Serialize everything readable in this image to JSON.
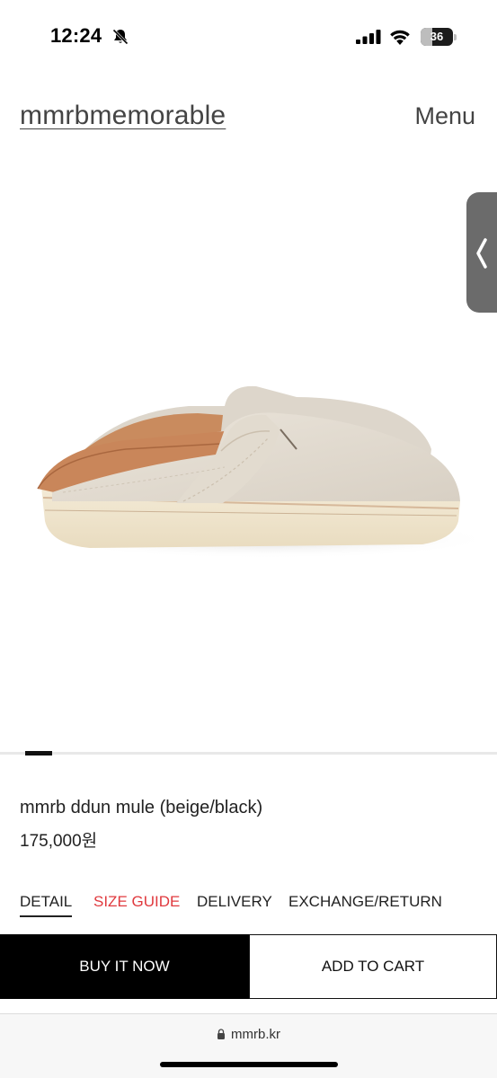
{
  "status_bar": {
    "time": "12:24",
    "battery": "36",
    "battery_level": 0.36,
    "icons": [
      "bell-slash-icon",
      "cellular-signal-icon",
      "wifi-icon",
      "battery-icon"
    ]
  },
  "header": {
    "brand": "mmrbmemorable",
    "menu_label": "Menu"
  },
  "side_handle": {
    "icon": "chevron-left-icon"
  },
  "product": {
    "image_alt": "beige suede mule",
    "name": "mmrb ddun mule (beige/black)",
    "price": "175,000원",
    "slider": {
      "current": 1
    }
  },
  "tabs": [
    {
      "label": "DETAIL",
      "active": true
    },
    {
      "label": "SIZE GUIDE",
      "highlight": true
    },
    {
      "label": "DELIVERY"
    },
    {
      "label": "EXCHANGE/RETURN"
    }
  ],
  "actions": {
    "buy_label": "BUY IT NOW",
    "cart_label": "ADD TO CART"
  },
  "browser": {
    "url": "mmrb.kr",
    "icon": "lock-icon"
  },
  "colors": {
    "accent_red": "#e0393e",
    "button_black": "#000000",
    "shoe_beige": "#e6dfd4",
    "leather_tan": "#c9865a"
  }
}
